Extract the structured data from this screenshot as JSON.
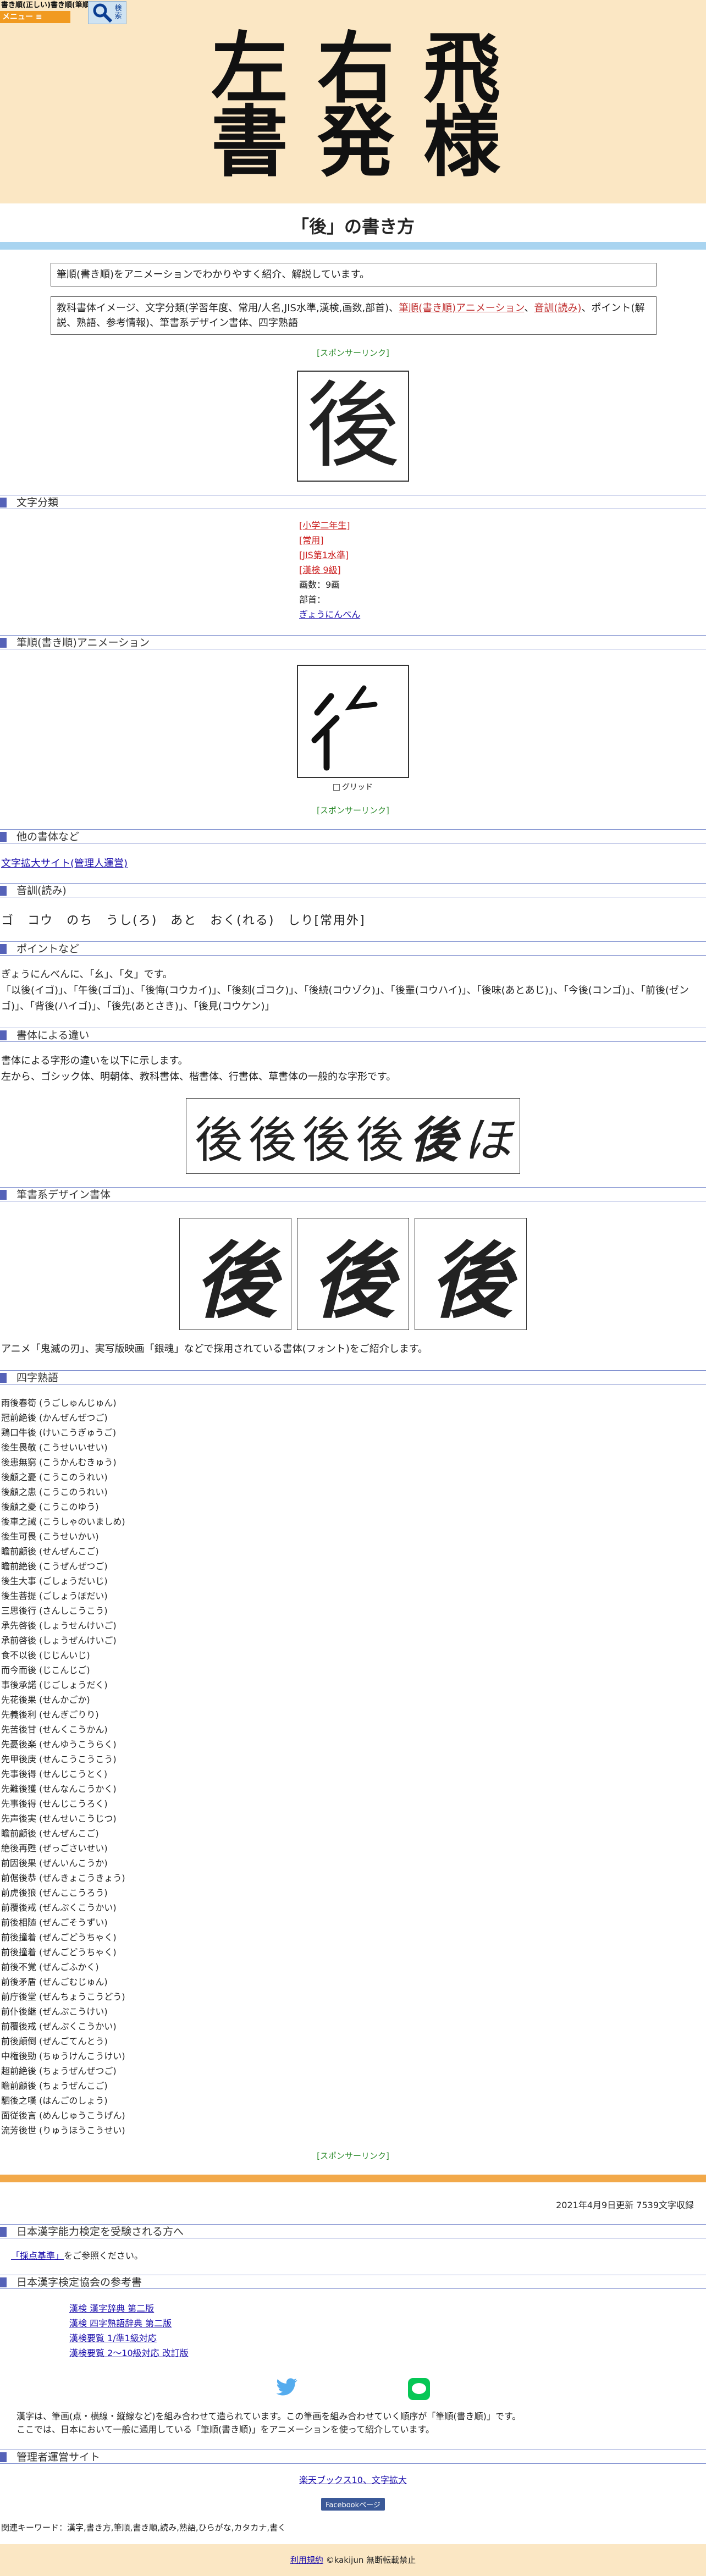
{
  "header": {
    "logo_line1": "書き順(正しい)書き順(筆順)",
    "menu_label": "メニュー ≡",
    "search_label": "検索",
    "title_chars": [
      "飛",
      "右",
      "左",
      "様",
      "発",
      "書"
    ]
  },
  "page_title": "「後」の書き方",
  "intro": {
    "line1": "筆順(書き順)をアニメーションでわかりやすく紹介、解説しています。",
    "line2_a": "教科書体イメージ、文字分類(学習年度、常用/人名,JIS水準,漢検,画数,部首)、",
    "line2_link1": "筆順(書き順)アニメーション",
    "line2_sep": "、",
    "line2_link2": "音訓(読み)",
    "line2_b": "、ポイント(解説、熟語、参考情報)、筆書系デザイン書体、四字熟語"
  },
  "sponsor": "[スポンサーリンク]",
  "kanji": "後",
  "sections": {
    "class": "文字分類",
    "anim": "筆順(書き順)アニメーション",
    "other": "他の書体など",
    "reading": "音訓(読み)",
    "point": "ポイントなど",
    "diff": "書体による違い",
    "design": "筆書系デザイン書体",
    "yoji": "四字熟語"
  },
  "classification": {
    "grade": "[小学二年生]",
    "jouyou": "[常用]",
    "jis": "[JIS第1水準]",
    "kanken": "[漢検 9級]",
    "strokes": "画数：9画",
    "radical": "部首：",
    "radical_name": "ぎょうにんべん"
  },
  "grid_label": "グリッド",
  "other_link": "文字拡大サイト(管理人運営)",
  "readings": "ゴ　コウ　のち　うし(ろ)　あと　おく(れる)　しり[常用外]",
  "point_text": "ぎょうにんべんに、「幺」、「夂」です。\n「以後(イゴ)」、「午後(ゴゴ)」、「後悔(コウカイ)」、「後刻(ゴコク)」、「後続(コウゾク)」、「後輩(コウハイ)」、「後味(あとあじ)」、「今後(コンゴ)」、「前後(ゼンゴ)」、「背後(ハイゴ)」、「後先(あとさき)」、「後見(コウケン)」",
  "diff_text": "書体による字形の違いを以下に示します。\n左から、ゴシック体、明朝体、教科書体、楷書体、行書体、草書体の一般的な字形です。",
  "style_chars": [
    "後",
    "後",
    "後",
    "後",
    "後",
    "ほ"
  ],
  "design_chars": [
    "後",
    "後",
    "後"
  ],
  "design_text": "アニメ「鬼滅の刃」、実写版映画「銀魂」などで採用されている書体(フォント)をご紹介します。",
  "yoji": [
    "雨後春筍 (うごしゅんじゅん)",
    "冠前絶後 (かんぜんぜつご)",
    "鶏口牛後 (けいこうぎゅうご)",
    "後生畏敬 (こうせいいせい)",
    "後患無窮 (こうかんむきゅう)",
    "後顧之憂 (こうこのうれい)",
    "後顧之患 (こうこのうれい)",
    "後顧之憂 (こうこのゆう)",
    "後車之誡 (こうしゃのいましめ)",
    "後生可畏 (こうせいかい)",
    "瞻前顧後 (せんぜんこご)",
    "瞻前絶後 (こうぜんぜつご)",
    "後生大事 (ごしょうだいじ)",
    "後生菩提 (ごしょうぼだい)",
    "三思後行 (さんしこうこう)",
    "承先啓後 (しょうせんけいご)",
    "承前啓後 (しょうぜんけいご)",
    "食不以後 (じじんいじ)",
    "而今而後 (じこんじご)",
    "事後承諾 (じごしょうだく)",
    "先花後果 (せんかごか)",
    "先義後利 (せんぎごりり)",
    "先苦後甘 (せんくこうかん)",
    "先憂後楽 (せんゆうこうらく)",
    "先甲後庚 (せんこうこうこう)",
    "先事後得 (せんじこうとく)",
    "先難後獲 (せんなんこうかく)",
    "先事後得 (せんじこうろく)",
    "先声後実 (せんせいこうじつ)",
    "瞻前顧後 (せんぜんこご)",
    "絶後再甦 (ぜっごさいせい)",
    "前因後果 (ぜんいんこうか)",
    "前倨後恭 (ぜんきょこうきょう)",
    "前虎後狼 (ぜんここうろう)",
    "前覆後戒 (ぜんぷくこうかい)",
    "前後相随 (ぜんごそうずい)",
    "前後撞着 (ぜんごどうちゃく)",
    "前後撞着 (ぜんごどうちゃく)",
    "前後不覚 (ぜんごふかく)",
    "前後矛盾 (ぜんごむじゅん)",
    "前庁後堂 (ぜんちょうこうどう)",
    "前仆後継 (ぜんぷこうけい)",
    "前覆後戒 (ぜんぷくこうかい)",
    "前後顛倒 (ぜんごてんとう)",
    "中権後勁 (ちゅうけんこうけい)",
    "超前絶後 (ちょうぜんぜつご)",
    "瞻前顧後 (ちょうぜんこご)",
    "駟後之嘆 (はんごのしょう)",
    "面従後言 (めんじゅうこうげん)",
    "流芳後世 (りゅうほうこうせい)"
  ],
  "updated": "2021年4月9日更新 7539文字収録",
  "bottom_sections": {
    "kentei": "日本漢字能力検定を受験される方へ",
    "books": "日本漢字検定協会の参考書",
    "admin": "管理者運営サイト"
  },
  "kentei_link": "「採点基準」",
  "kentei_text": "をご参照ください。",
  "books": [
    "漢検 漢字辞典 第二版",
    "漢検 四字熟語辞典 第二版",
    "漢検要覧 1/準1級対応",
    "漢検要覧 2～10級対応 改訂版"
  ],
  "note": "漢字は、筆画(点・横線・縦線など)を組み合わせて造られています。この筆画を組み合わせていく順序が「筆順(書き順)」です。\nここでは、日本において一般に通用している「筆順(書き順)」をアニメーションを使って紹介しています。",
  "admin_links": [
    "楽天ブックス10、文字拡大"
  ],
  "fb_label": "Facebookページ",
  "keywords": "関連キーワード：漢字,書き方,筆順,書き順,読み,熟語,ひらがな,カタカナ,書く",
  "footer": {
    "terms": "利用規約",
    "copy": "©kakijun 無断転載禁止"
  },
  "colors": {
    "header_bg": "#fbe7c4",
    "accent": "#f19a20",
    "section_bar": "#5562b8",
    "blue_band": "#a9d4f0"
  }
}
